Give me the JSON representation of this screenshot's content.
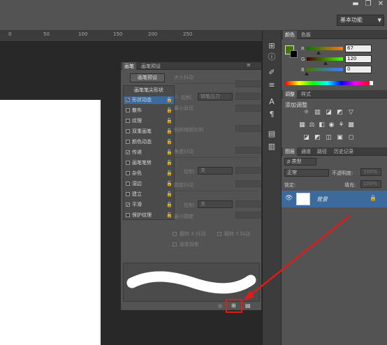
{
  "topbar": {
    "workspace": "基本功能",
    "win_min": "▬",
    "win_restore": "❐",
    "win_close": "✕"
  },
  "ruler": {
    "labels": [
      "0",
      "50",
      "100",
      "150",
      "200",
      "250"
    ]
  },
  "color_panel": {
    "tabs": [
      "颜色",
      "色板"
    ],
    "r_label": "R",
    "g_label": "G",
    "b_label": "B",
    "r": "67",
    "g": "120",
    "b": "0",
    "fg_color": "#437800"
  },
  "adjust_panel": {
    "tabs": [
      "调整",
      "样式"
    ],
    "title": "添加调整"
  },
  "layers_panel": {
    "tabs": [
      "图层",
      "通道",
      "路径",
      "历史记录"
    ],
    "filter": "ρ 类型",
    "blend_mode": "正常",
    "opacity_label": "不透明度:",
    "opacity_value": "100%",
    "lock_label": "锁定:",
    "fill_label": "填充:",
    "fill_value": "100%",
    "layer_name": "背景"
  },
  "brush_panel": {
    "tabs": [
      "画笔",
      "画笔预设"
    ],
    "preset_button": "画笔预设",
    "list_header": "画笔笔尖形状",
    "items": [
      {
        "label": "形状动态",
        "checked": true
      },
      {
        "label": "散布",
        "checked": false
      },
      {
        "label": "纹理",
        "checked": false
      },
      {
        "label": "双重画笔",
        "checked": false
      },
      {
        "label": "颜色动态",
        "checked": false
      },
      {
        "label": "传递",
        "checked": true
      },
      {
        "label": "画笔笔势",
        "checked": false
      },
      {
        "label": "杂色",
        "checked": false
      },
      {
        "label": "湿边",
        "checked": false
      },
      {
        "label": "建立",
        "checked": false
      },
      {
        "label": "平滑",
        "checked": true
      },
      {
        "label": "保护纹理",
        "checked": false
      }
    ],
    "size_jitter": "大小抖动",
    "control": "控制:",
    "control_pressure": "钢笔压力",
    "min_diameter": "最小直径",
    "tilt_scale": "倾斜缩放比例",
    "angle_jitter": "角度抖动",
    "control_off": "关",
    "roundness_jitter": "圆度抖动",
    "min_roundness": "最小圆度",
    "flip_x": "翻转 X 抖动",
    "flip_y": "翻转 Y 抖动",
    "brush_projection": "画笔投影"
  }
}
